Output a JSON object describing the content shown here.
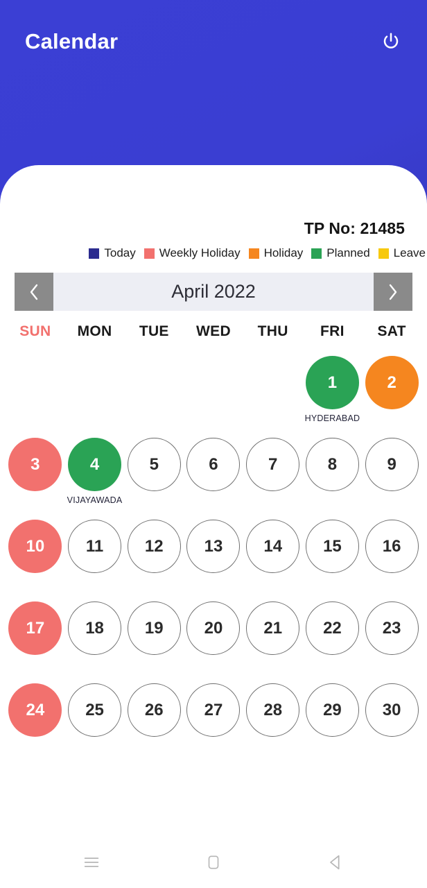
{
  "appbar": {
    "title": "Calendar",
    "power_icon": "power-icon"
  },
  "card": {
    "tp_no": "TP No: 21485"
  },
  "legend": {
    "items": [
      {
        "label": "Today",
        "color": "#2b2b8f"
      },
      {
        "label": "Weekly Holiday",
        "color": "#f2716e"
      },
      {
        "label": "Holiday",
        "color": "#f5861f"
      },
      {
        "label": "Planned",
        "color": "#2aa355"
      },
      {
        "label": "Leave",
        "color": "#f7c90e"
      }
    ]
  },
  "month_nav": {
    "prev_icon": "chevron-left-icon",
    "next_icon": "chevron-right-icon",
    "month_label": "April 2022"
  },
  "weekdays": [
    {
      "label": "SUN",
      "is_sunday": true
    },
    {
      "label": "MON",
      "is_sunday": false
    },
    {
      "label": "TUE",
      "is_sunday": false
    },
    {
      "label": "WED",
      "is_sunday": false
    },
    {
      "label": "THU",
      "is_sunday": false
    },
    {
      "label": "FRI",
      "is_sunday": false
    },
    {
      "label": "SAT",
      "is_sunday": false
    }
  ],
  "days": [
    {
      "day": "",
      "blank": true
    },
    {
      "day": "",
      "blank": true
    },
    {
      "day": "",
      "blank": true
    },
    {
      "day": "",
      "blank": true
    },
    {
      "day": "",
      "blank": true
    },
    {
      "day": "1",
      "fill": "#2aa355",
      "note": "HYDERABAD"
    },
    {
      "day": "2",
      "fill": "#f5861f",
      "note": ""
    },
    {
      "day": "3",
      "fill": "#f2716e",
      "note": ""
    },
    {
      "day": "4",
      "fill": "#2aa355",
      "note": "VIJAYAWADA"
    },
    {
      "day": "5",
      "fill": "",
      "note": ""
    },
    {
      "day": "6",
      "fill": "",
      "note": ""
    },
    {
      "day": "7",
      "fill": "",
      "note": ""
    },
    {
      "day": "8",
      "fill": "",
      "note": ""
    },
    {
      "day": "9",
      "fill": "",
      "note": ""
    },
    {
      "day": "10",
      "fill": "#f2716e",
      "note": ""
    },
    {
      "day": "11",
      "fill": "",
      "note": ""
    },
    {
      "day": "12",
      "fill": "",
      "note": ""
    },
    {
      "day": "13",
      "fill": "",
      "note": ""
    },
    {
      "day": "14",
      "fill": "",
      "note": ""
    },
    {
      "day": "15",
      "fill": "",
      "note": ""
    },
    {
      "day": "16",
      "fill": "",
      "note": ""
    },
    {
      "day": "17",
      "fill": "#f2716e",
      "note": ""
    },
    {
      "day": "18",
      "fill": "",
      "note": ""
    },
    {
      "day": "19",
      "fill": "",
      "note": ""
    },
    {
      "day": "20",
      "fill": "",
      "note": ""
    },
    {
      "day": "21",
      "fill": "",
      "note": ""
    },
    {
      "day": "22",
      "fill": "",
      "note": ""
    },
    {
      "day": "23",
      "fill": "",
      "note": ""
    },
    {
      "day": "24",
      "fill": "#f2716e",
      "note": ""
    },
    {
      "day": "25",
      "fill": "",
      "note": ""
    },
    {
      "day": "26",
      "fill": "",
      "note": ""
    },
    {
      "day": "27",
      "fill": "",
      "note": ""
    },
    {
      "day": "28",
      "fill": "",
      "note": ""
    },
    {
      "day": "29",
      "fill": "",
      "note": ""
    },
    {
      "day": "30",
      "fill": "",
      "note": ""
    }
  ],
  "system_nav": {
    "recents_icon": "menu-icon",
    "home_icon": "home-square-icon",
    "back_icon": "back-triangle-icon"
  }
}
